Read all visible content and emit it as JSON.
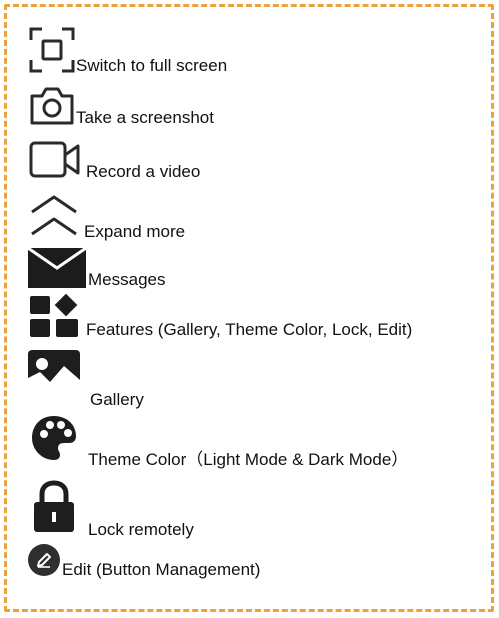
{
  "legend": {
    "items": [
      {
        "icon": "fullscreen-icon",
        "label": "Switch to full screen"
      },
      {
        "icon": "camera-icon",
        "label": "Take a screenshot"
      },
      {
        "icon": "video-camera-icon",
        "label": "Record a video"
      },
      {
        "icon": "expand-more-icon",
        "label": "Expand more"
      },
      {
        "icon": "messages-icon",
        "label": "Messages"
      },
      {
        "icon": "features-icon",
        "label": "Features (Gallery, Theme Color, Lock, Edit)"
      },
      {
        "icon": "gallery-icon",
        "label": "Gallery"
      },
      {
        "icon": "palette-icon",
        "label": "Theme Color（Light Mode & Dark Mode）"
      },
      {
        "icon": "lock-icon",
        "label": "Lock remotely"
      },
      {
        "icon": "edit-icon",
        "label": "Edit (Button Management)"
      }
    ]
  },
  "colors": {
    "border": "#f0a23a",
    "icon": "#2a2a2a"
  }
}
